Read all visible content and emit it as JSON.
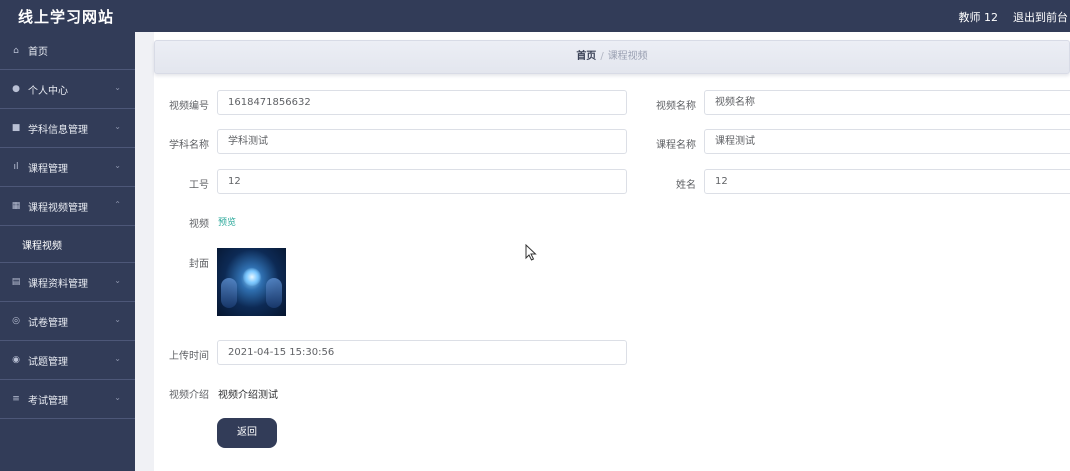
{
  "brand": "线上学习网站",
  "topbar": {
    "user": "教师 12",
    "exit": "退出到前台"
  },
  "sidebar": {
    "items": [
      {
        "label": "首页",
        "icon": "home-icon",
        "glyph": "⌂"
      },
      {
        "label": "个人中心",
        "icon": "user-icon",
        "glyph": "●",
        "chevron": "⌄"
      },
      {
        "label": "学科信息管理",
        "icon": "book-icon",
        "glyph": "■",
        "chevron": "⌄"
      },
      {
        "label": "课程管理",
        "icon": "bar-chart-icon",
        "glyph": "ıl",
        "chevron": "⌄"
      },
      {
        "label": "课程视频管理",
        "icon": "grid-icon",
        "glyph": "▦",
        "chevron": "⌃"
      },
      {
        "label": "课程资料管理",
        "icon": "document-icon",
        "glyph": "▤",
        "chevron": "⌄"
      },
      {
        "label": "试卷管理",
        "icon": "circle-icon",
        "glyph": "◎",
        "chevron": "⌄"
      },
      {
        "label": "试题管理",
        "icon": "question-icon",
        "glyph": "◉",
        "chevron": "⌄"
      },
      {
        "label": "考试管理",
        "icon": "list-icon",
        "glyph": "≡",
        "chevron": "⌄"
      }
    ],
    "subitem": "课程视频"
  },
  "breadcrumb": {
    "home": "首页",
    "separator": "/",
    "current": "课程视频"
  },
  "form": {
    "video_no": {
      "label": "视频编号",
      "value": "1618471856632"
    },
    "video_name": {
      "label": "视频名称",
      "value": "视频名称"
    },
    "subject_name": {
      "label": "学科名称",
      "value": "学科测试"
    },
    "course_name": {
      "label": "课程名称",
      "value": "课程测试"
    },
    "job_no": {
      "label": "工号",
      "value": "12"
    },
    "name": {
      "label": "姓名",
      "value": "12"
    },
    "video": {
      "label": "视频",
      "link": "预览"
    },
    "cover": {
      "label": "封面"
    },
    "upload_time": {
      "label": "上传时间",
      "value": "2021-04-15 15:30:56"
    },
    "intro": {
      "label": "视频介绍",
      "value": "视频介绍测试"
    }
  },
  "buttons": {
    "back": "返回"
  },
  "colors": {
    "sidebar_bg": "#323c58",
    "link": "#2aa89a",
    "button_bg": "#323c58"
  }
}
